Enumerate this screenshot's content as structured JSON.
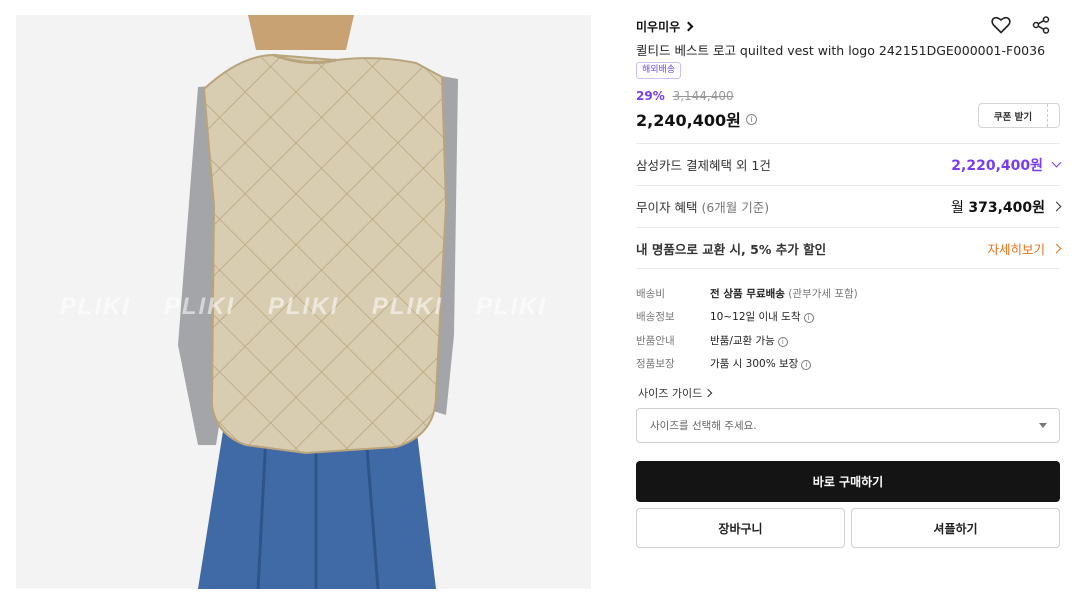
{
  "product": {
    "brand": "미우미우",
    "title": "퀼티드 베스트 로고 quilted vest with logo 242151DGE000001-F0036",
    "tag": "해외배송",
    "discount": "29%",
    "original_price": "3,144,400",
    "price": "2,240,400원",
    "coupon_label": "쿠폰 받기"
  },
  "gallery": {
    "watermark": [
      "PLIKI",
      "PLIKI",
      "PLIKI",
      "PLIKI",
      "PLIKI"
    ]
  },
  "rows": {
    "card_label": "삼성카드 결제혜택 외 1건",
    "card_amount": "2,220,400원",
    "installment_label": "무이자 혜택",
    "installment_sub": "(6개월 기준)",
    "installment_prefix": "월",
    "installment_amount": "373,400원",
    "exchange_label": "내 명품으로 교환 시, 5% 추가 할인",
    "exchange_link": "자세히보기"
  },
  "info": [
    {
      "key": "배송비",
      "bold": "전 상품 무료배송",
      "value": "(관부가세 포함)"
    },
    {
      "key": "배송정보",
      "value": "10~12일 이내 도착"
    },
    {
      "key": "반품안내",
      "value": "반품/교환 가능"
    },
    {
      "key": "정품보장",
      "value": "가품 시 300% 보장"
    }
  ],
  "size": {
    "guide_label": "사이즈 가이드",
    "placeholder": "사이즈를 선택해 주세요."
  },
  "buttons": {
    "buy": "바로 구매하기",
    "cart": "장바구니",
    "share": "셔플하기"
  },
  "icons": {
    "wishlist": "heart-icon",
    "share": "share-icon"
  },
  "colors": {
    "accent_purple": "#7a3cf0",
    "accent_orange": "#e8721c",
    "buy_button": "#141414"
  }
}
